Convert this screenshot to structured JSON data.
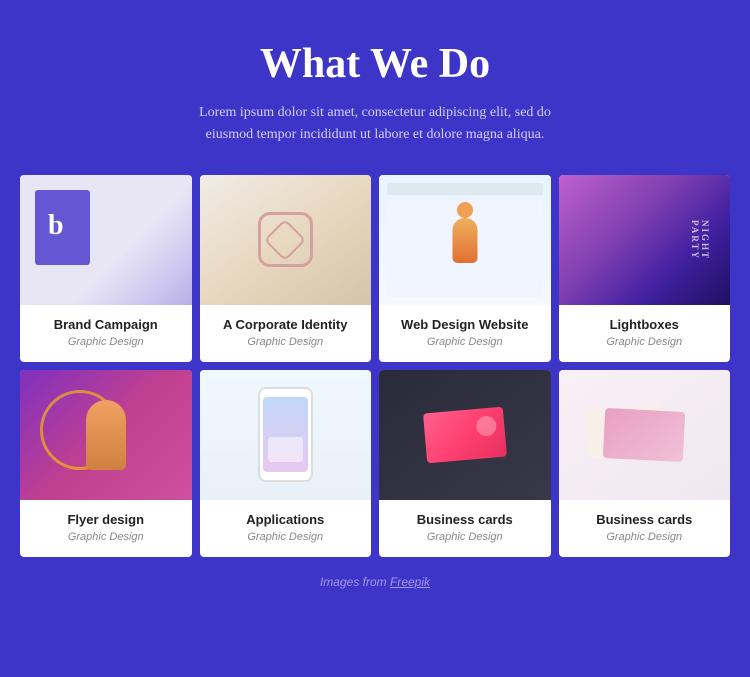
{
  "page": {
    "background_color": "#3d35c8"
  },
  "header": {
    "title": "What We Do",
    "description": "Lorem ipsum dolor sit amet, consectetur adipiscing elit, sed do eiusmod tempor incididunt ut labore et dolore magna aliqua."
  },
  "grid": {
    "rows": [
      [
        {
          "id": "brand-campaign",
          "title": "Brand Campaign",
          "subtitle": "Graphic Design",
          "img_class": "img-brand-campaign"
        },
        {
          "id": "corporate-identity",
          "title": "A Corporate Identity",
          "subtitle": "Graphic Design",
          "img_class": "img-corporate"
        },
        {
          "id": "web-design",
          "title": "Web Design Website",
          "subtitle": "Graphic Design",
          "img_class": "img-web-design"
        },
        {
          "id": "lightboxes",
          "title": "Lightboxes",
          "subtitle": "Graphic Design",
          "img_class": "img-lightboxes"
        }
      ],
      [
        {
          "id": "flyer-design",
          "title": "Flyer design",
          "subtitle": "Graphic Design",
          "img_class": "img-flyer"
        },
        {
          "id": "applications",
          "title": "Applications",
          "subtitle": "Graphic Design",
          "img_class": "img-applications"
        },
        {
          "id": "business-cards-1",
          "title": "Business cards",
          "subtitle": "Graphic Design",
          "img_class": "img-business1"
        },
        {
          "id": "business-cards-2",
          "title": "Business cards",
          "subtitle": "Graphic Design",
          "img_class": "img-business2"
        }
      ]
    ]
  },
  "footer": {
    "text": "Images from ",
    "link_label": "Freepik"
  }
}
